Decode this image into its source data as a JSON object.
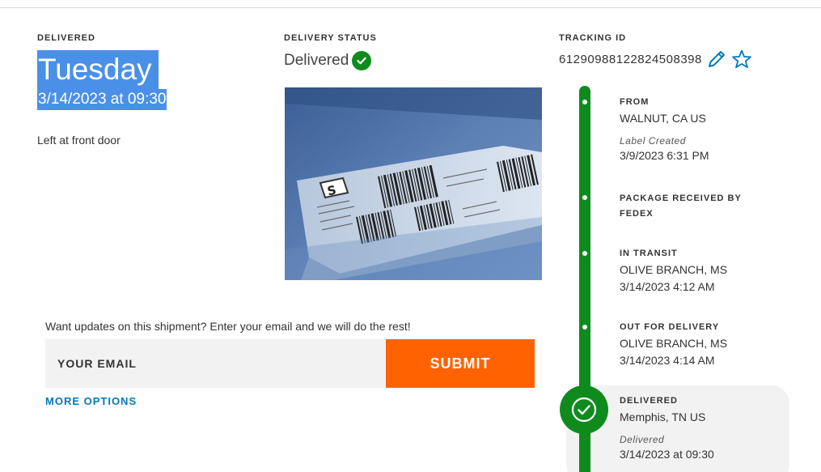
{
  "delivered": {
    "label": "DELIVERED",
    "day": "Tuesday",
    "datetime": "3/14/2023 at 09:30",
    "note": "Left at front door"
  },
  "status": {
    "label": "DELIVERY STATUS",
    "value": "Delivered",
    "icon": "check-circle-icon"
  },
  "tracking": {
    "label": "TRACKING ID",
    "id": "612909881228245083​98",
    "edit_icon": "pencil-icon",
    "favorite_icon": "star-icon"
  },
  "photo": {
    "icon": "package-label-photo"
  },
  "updates": {
    "prompt": "Want updates on this shipment? Enter your email and we will do the rest!",
    "email_placeholder": "YOUR EMAIL",
    "submit_label": "SUBMIT",
    "more_options": "MORE OPTIONS"
  },
  "timeline": [
    {
      "heading": "FROM",
      "line1": "WALNUT, CA US",
      "italic": "Label Created",
      "line2": "3/9/2023 6:31 PM"
    },
    {
      "heading": "PACKAGE RECEIVED BY",
      "heading2": "FEDEX"
    },
    {
      "heading": "IN TRANSIT",
      "line1": "OLIVE BRANCH, MS",
      "line2": "3/14/2023 4:12 AM"
    },
    {
      "heading": "OUT FOR DELIVERY",
      "line1": "OLIVE BRANCH, MS",
      "line2": "3/14/2023 4:14 AM"
    },
    {
      "heading": "DELIVERED",
      "line1": "Memphis, TN US",
      "italic": "Delivered",
      "line2": "3/14/2023 at 09:30"
    }
  ],
  "colors": {
    "accent_green": "#0f8b1e",
    "submit_orange": "#ff6200",
    "link_blue": "#007ab7",
    "selection_blue": "#4a90e8"
  }
}
